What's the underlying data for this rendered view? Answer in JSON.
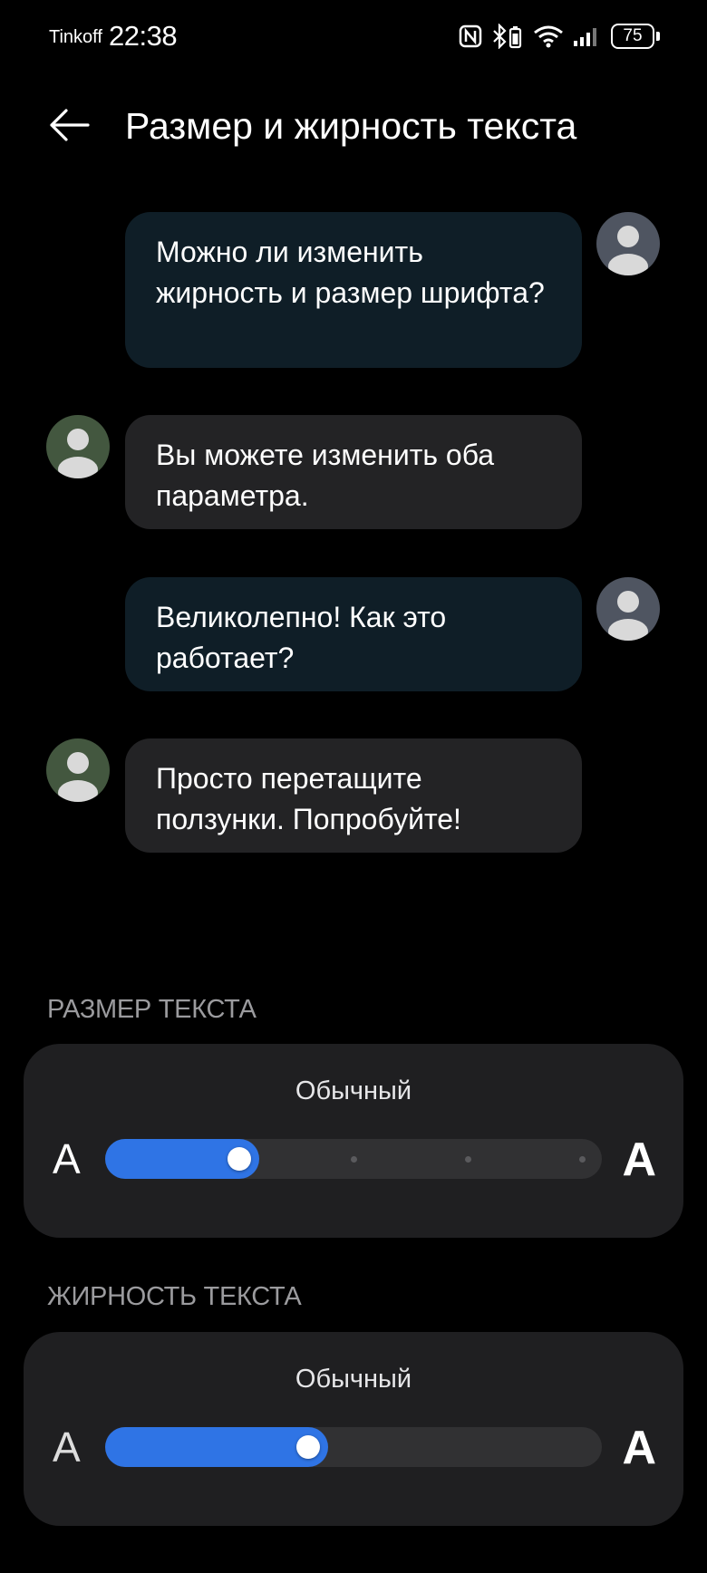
{
  "status_bar": {
    "carrier": "Tinkoff",
    "time": "22:38",
    "battery": "75",
    "icons": [
      "nfc-icon",
      "bluetooth-battery-icon",
      "wifi-icon",
      "signal-icon",
      "battery-icon"
    ]
  },
  "header": {
    "back_icon": "arrow-left-icon",
    "title": "Размер и жирность текста"
  },
  "chat": {
    "messages": [
      {
        "side": "out",
        "text": "Можно ли изменить жирность и размер шрифта?"
      },
      {
        "side": "in",
        "text": "Вы можете изменить оба параметра."
      },
      {
        "side": "out",
        "text": "Великолепно! Как это работает?"
      },
      {
        "side": "in",
        "text": "Просто перетащите ползунки. Попробуйте!"
      }
    ]
  },
  "text_size": {
    "label": "РАЗМЕР ТЕКСТА",
    "value": "Обычный",
    "small_glyph": "A",
    "large_glyph": "A",
    "position": 1,
    "steps": 5
  },
  "text_weight": {
    "label": "ЖИРНОСТЬ ТЕКСТА",
    "value": "Обычный",
    "small_glyph": "A",
    "large_glyph": "A",
    "level": 0.4
  },
  "colors": {
    "background": "#000000",
    "accent": "#2f74e5",
    "bubble_out": "#0f1e27",
    "bubble_in": "#232325",
    "card": "#1f1f21"
  }
}
